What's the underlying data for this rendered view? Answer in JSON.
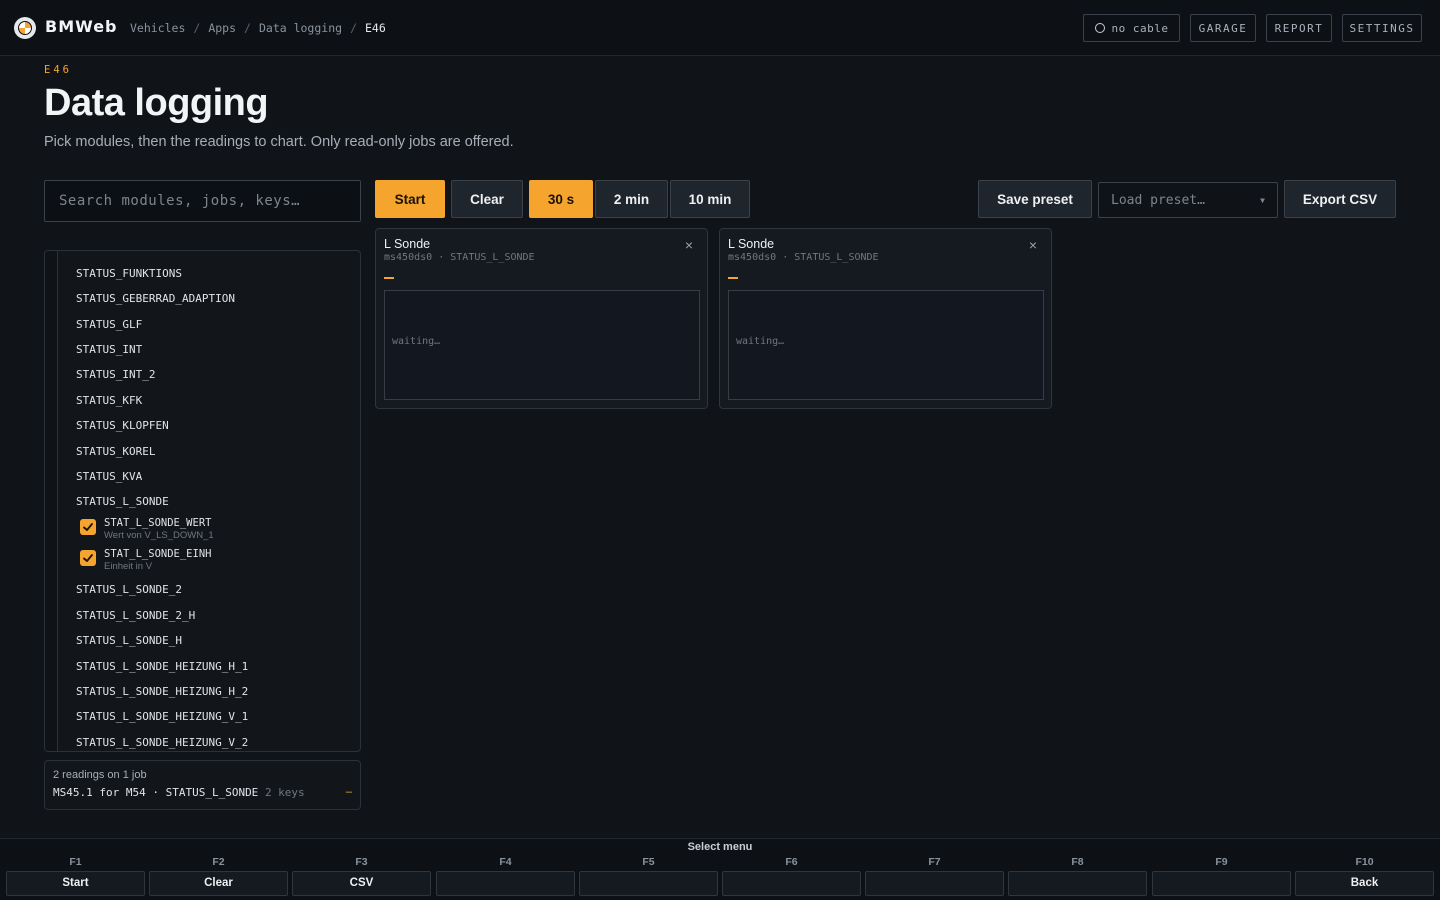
{
  "topbar": {
    "brand": "BMWeb",
    "breadcrumbs": [
      "Vehicles",
      "Apps",
      "Data logging",
      "E46"
    ],
    "separator": "/",
    "cable_status": "no cable",
    "buttons": {
      "garage": "GARAGE",
      "report": "REPORT",
      "settings": "SETTINGS"
    }
  },
  "header": {
    "eyebrow": "E46",
    "title": "Data logging",
    "subtitle": "Pick modules, then the readings to chart. Only read-only jobs are offered."
  },
  "search": {
    "placeholder": "Search modules, jobs, keys…",
    "value": ""
  },
  "toolbar": {
    "start": "Start",
    "clear": "Clear",
    "windows": [
      "30 s",
      "2 min",
      "10 min"
    ],
    "selected_window": "30 s",
    "save_preset": "Save preset",
    "load_preset_placeholder": "Load preset…",
    "export_csv": "Export CSV"
  },
  "job_list": {
    "items": [
      "STATUS_FUNKTIONS",
      "STATUS_GEBERRAD_ADAPTION",
      "STATUS_GLF",
      "STATUS_INT",
      "STATUS_INT_2",
      "STATUS_KFK",
      "STATUS_KLOPFEN",
      "STATUS_KOREL",
      "STATUS_KVA",
      "STATUS_L_SONDE",
      "STATUS_L_SONDE_2",
      "STATUS_L_SONDE_2_H",
      "STATUS_L_SONDE_H",
      "STATUS_L_SONDE_HEIZUNG_H_1",
      "STATUS_L_SONDE_HEIZUNG_H_2",
      "STATUS_L_SONDE_HEIZUNG_V_1",
      "STATUS_L_SONDE_HEIZUNG_V_2"
    ],
    "expanded_keys": [
      {
        "key": "STAT_L_SONDE_WERT",
        "desc": "Wert von V_LS_DOWN_1",
        "checked": true
      },
      {
        "key": "STAT_L_SONDE_EINH",
        "desc": "Einheit in V",
        "checked": true
      }
    ]
  },
  "summary": {
    "line1": "2 readings on 1 job",
    "module": "MS45.1 for M54",
    "dot": "·",
    "job": "STATUS_L_SONDE",
    "keys": "2 keys",
    "dash": "–"
  },
  "charts": [
    {
      "title": "L Sonde",
      "module": "ms450ds0",
      "job": "STATUS_L_SONDE",
      "dash": "—",
      "status": "waiting…"
    },
    {
      "title": "L Sonde",
      "module": "ms450ds0",
      "job": "STATUS_L_SONDE",
      "dash": "—",
      "status": "waiting…"
    }
  ],
  "card_close": "×",
  "footer": {
    "title": "Select menu",
    "keys": [
      {
        "key": "F1",
        "label": "Start"
      },
      {
        "key": "F2",
        "label": "Clear"
      },
      {
        "key": "F3",
        "label": "CSV"
      },
      {
        "key": "F4",
        "label": ""
      },
      {
        "key": "F5",
        "label": ""
      },
      {
        "key": "F6",
        "label": ""
      },
      {
        "key": "F7",
        "label": ""
      },
      {
        "key": "F8",
        "label": ""
      },
      {
        "key": "F9",
        "label": ""
      },
      {
        "key": "F10",
        "label": "Back"
      }
    ]
  },
  "colors": {
    "accent": "#f5a52e",
    "background": "#101419",
    "panel": "#12161b"
  }
}
